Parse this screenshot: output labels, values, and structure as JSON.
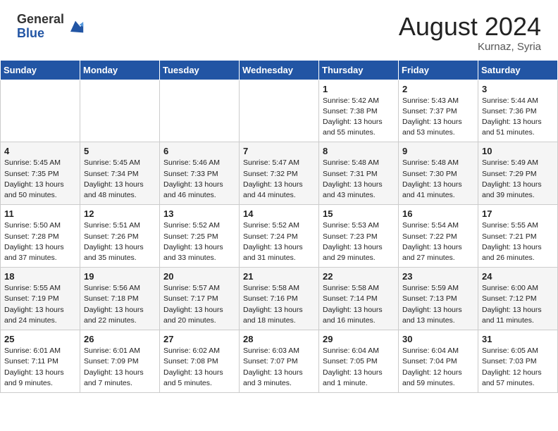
{
  "header": {
    "logo_general": "General",
    "logo_blue": "Blue",
    "month_year": "August 2024",
    "location": "Kurnaz, Syria"
  },
  "weekdays": [
    "Sunday",
    "Monday",
    "Tuesday",
    "Wednesday",
    "Thursday",
    "Friday",
    "Saturday"
  ],
  "weeks": [
    [
      {
        "day": "",
        "info": ""
      },
      {
        "day": "",
        "info": ""
      },
      {
        "day": "",
        "info": ""
      },
      {
        "day": "",
        "info": ""
      },
      {
        "day": "1",
        "info": "Sunrise: 5:42 AM\nSunset: 7:38 PM\nDaylight: 13 hours\nand 55 minutes."
      },
      {
        "day": "2",
        "info": "Sunrise: 5:43 AM\nSunset: 7:37 PM\nDaylight: 13 hours\nand 53 minutes."
      },
      {
        "day": "3",
        "info": "Sunrise: 5:44 AM\nSunset: 7:36 PM\nDaylight: 13 hours\nand 51 minutes."
      }
    ],
    [
      {
        "day": "4",
        "info": "Sunrise: 5:45 AM\nSunset: 7:35 PM\nDaylight: 13 hours\nand 50 minutes."
      },
      {
        "day": "5",
        "info": "Sunrise: 5:45 AM\nSunset: 7:34 PM\nDaylight: 13 hours\nand 48 minutes."
      },
      {
        "day": "6",
        "info": "Sunrise: 5:46 AM\nSunset: 7:33 PM\nDaylight: 13 hours\nand 46 minutes."
      },
      {
        "day": "7",
        "info": "Sunrise: 5:47 AM\nSunset: 7:32 PM\nDaylight: 13 hours\nand 44 minutes."
      },
      {
        "day": "8",
        "info": "Sunrise: 5:48 AM\nSunset: 7:31 PM\nDaylight: 13 hours\nand 43 minutes."
      },
      {
        "day": "9",
        "info": "Sunrise: 5:48 AM\nSunset: 7:30 PM\nDaylight: 13 hours\nand 41 minutes."
      },
      {
        "day": "10",
        "info": "Sunrise: 5:49 AM\nSunset: 7:29 PM\nDaylight: 13 hours\nand 39 minutes."
      }
    ],
    [
      {
        "day": "11",
        "info": "Sunrise: 5:50 AM\nSunset: 7:28 PM\nDaylight: 13 hours\nand 37 minutes."
      },
      {
        "day": "12",
        "info": "Sunrise: 5:51 AM\nSunset: 7:26 PM\nDaylight: 13 hours\nand 35 minutes."
      },
      {
        "day": "13",
        "info": "Sunrise: 5:52 AM\nSunset: 7:25 PM\nDaylight: 13 hours\nand 33 minutes."
      },
      {
        "day": "14",
        "info": "Sunrise: 5:52 AM\nSunset: 7:24 PM\nDaylight: 13 hours\nand 31 minutes."
      },
      {
        "day": "15",
        "info": "Sunrise: 5:53 AM\nSunset: 7:23 PM\nDaylight: 13 hours\nand 29 minutes."
      },
      {
        "day": "16",
        "info": "Sunrise: 5:54 AM\nSunset: 7:22 PM\nDaylight: 13 hours\nand 27 minutes."
      },
      {
        "day": "17",
        "info": "Sunrise: 5:55 AM\nSunset: 7:21 PM\nDaylight: 13 hours\nand 26 minutes."
      }
    ],
    [
      {
        "day": "18",
        "info": "Sunrise: 5:55 AM\nSunset: 7:19 PM\nDaylight: 13 hours\nand 24 minutes."
      },
      {
        "day": "19",
        "info": "Sunrise: 5:56 AM\nSunset: 7:18 PM\nDaylight: 13 hours\nand 22 minutes."
      },
      {
        "day": "20",
        "info": "Sunrise: 5:57 AM\nSunset: 7:17 PM\nDaylight: 13 hours\nand 20 minutes."
      },
      {
        "day": "21",
        "info": "Sunrise: 5:58 AM\nSunset: 7:16 PM\nDaylight: 13 hours\nand 18 minutes."
      },
      {
        "day": "22",
        "info": "Sunrise: 5:58 AM\nSunset: 7:14 PM\nDaylight: 13 hours\nand 16 minutes."
      },
      {
        "day": "23",
        "info": "Sunrise: 5:59 AM\nSunset: 7:13 PM\nDaylight: 13 hours\nand 13 minutes."
      },
      {
        "day": "24",
        "info": "Sunrise: 6:00 AM\nSunset: 7:12 PM\nDaylight: 13 hours\nand 11 minutes."
      }
    ],
    [
      {
        "day": "25",
        "info": "Sunrise: 6:01 AM\nSunset: 7:11 PM\nDaylight: 13 hours\nand 9 minutes."
      },
      {
        "day": "26",
        "info": "Sunrise: 6:01 AM\nSunset: 7:09 PM\nDaylight: 13 hours\nand 7 minutes."
      },
      {
        "day": "27",
        "info": "Sunrise: 6:02 AM\nSunset: 7:08 PM\nDaylight: 13 hours\nand 5 minutes."
      },
      {
        "day": "28",
        "info": "Sunrise: 6:03 AM\nSunset: 7:07 PM\nDaylight: 13 hours\nand 3 minutes."
      },
      {
        "day": "29",
        "info": "Sunrise: 6:04 AM\nSunset: 7:05 PM\nDaylight: 13 hours\nand 1 minute."
      },
      {
        "day": "30",
        "info": "Sunrise: 6:04 AM\nSunset: 7:04 PM\nDaylight: 12 hours\nand 59 minutes."
      },
      {
        "day": "31",
        "info": "Sunrise: 6:05 AM\nSunset: 7:03 PM\nDaylight: 12 hours\nand 57 minutes."
      }
    ]
  ]
}
